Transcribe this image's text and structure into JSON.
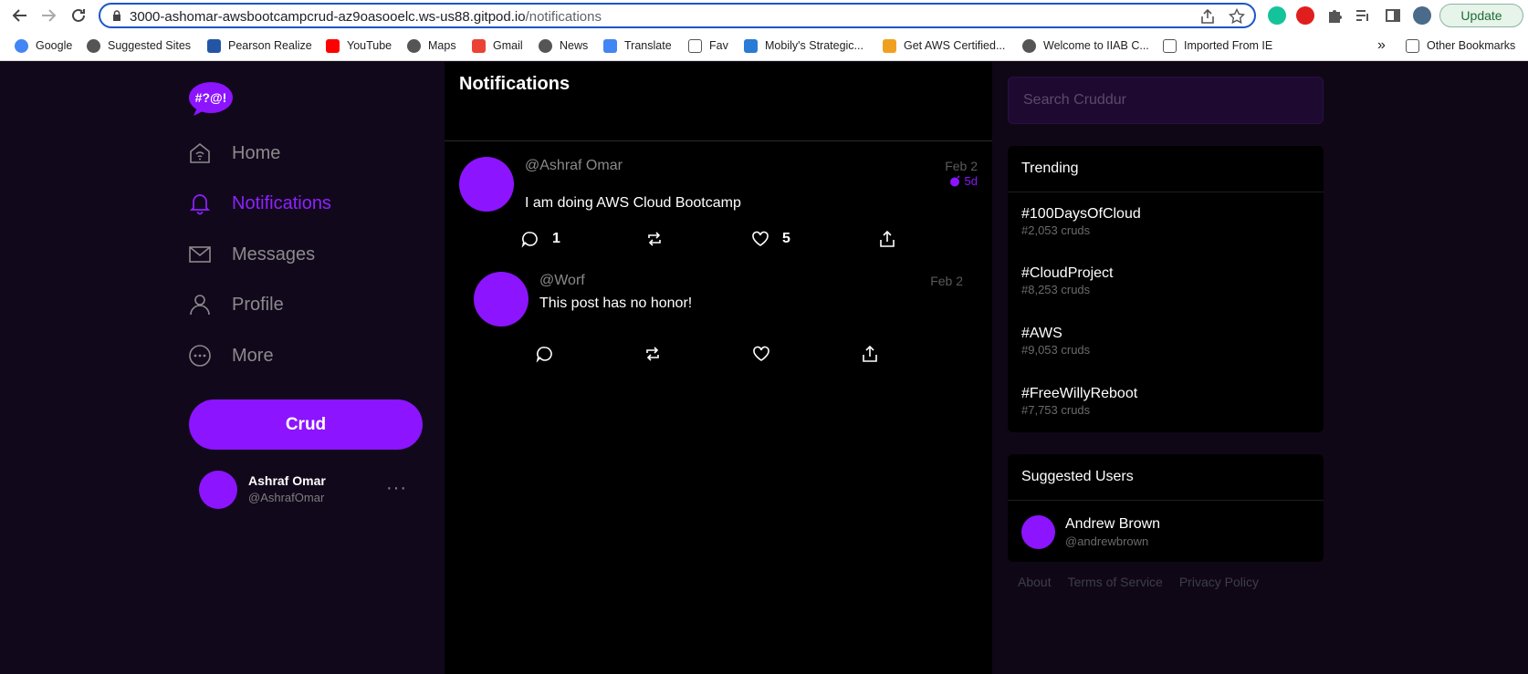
{
  "browser": {
    "url_host": "3000-ashomar-awsbootcampcrud-az9oasooelc.ws-us88.gitpod.io",
    "url_path": "/notifications",
    "update_label": "Update",
    "bookmarks": [
      {
        "label": "Google",
        "icon": "google-icon"
      },
      {
        "label": "Suggested Sites",
        "icon": "globe-icon"
      },
      {
        "label": "Pearson Realize",
        "icon": "pearson-icon"
      },
      {
        "label": "YouTube",
        "icon": "youtube-icon"
      },
      {
        "label": "Maps",
        "icon": "globe-icon"
      },
      {
        "label": "Gmail",
        "icon": "gmail-icon"
      },
      {
        "label": "News",
        "icon": "globe-icon"
      },
      {
        "label": "Translate",
        "icon": "translate-icon"
      },
      {
        "label": "Fav",
        "icon": "folder-icon"
      },
      {
        "label": "Mobily's Strategic...",
        "icon": "mobily-icon"
      },
      {
        "label": "Get AWS Certified...",
        "icon": "aws-icon"
      },
      {
        "label": "Welcome to IIAB C...",
        "icon": "globe-icon"
      },
      {
        "label": "Imported From IE",
        "icon": "folder-icon"
      }
    ],
    "overflow_label": "»",
    "other_bookmarks_label": "Other Bookmarks"
  },
  "sidebar": {
    "logo_text": "#?@!",
    "items": [
      {
        "label": "Home",
        "icon": "home-icon",
        "active": false
      },
      {
        "label": "Notifications",
        "icon": "bell-icon",
        "active": true
      },
      {
        "label": "Messages",
        "icon": "envelope-icon",
        "active": false
      },
      {
        "label": "Profile",
        "icon": "user-icon",
        "active": false
      },
      {
        "label": "More",
        "icon": "more-circle-icon",
        "active": false
      }
    ],
    "crud_label": "Crud",
    "user": {
      "name": "Ashraf Omar",
      "handle": "@AshrafOmar",
      "more": "···"
    }
  },
  "feed": {
    "title": "Notifications",
    "posts": [
      {
        "handle": "@Ashraf Omar",
        "date": "Feb 2",
        "ago": "5d",
        "content": "I am doing AWS Cloud Bootcamp",
        "replies": "1",
        "likes": "5"
      },
      {
        "handle": "@Worf",
        "date": "Feb 2",
        "content": "This post has no honor!",
        "replies": "",
        "likes": ""
      }
    ]
  },
  "right": {
    "search_placeholder": "Search Cruddur",
    "trending_title": "Trending",
    "trends": [
      {
        "tag": "#100DaysOfCloud",
        "count": "#2,053 cruds"
      },
      {
        "tag": "#CloudProject",
        "count": "#8,253 cruds"
      },
      {
        "tag": "#AWS",
        "count": "#9,053 cruds"
      },
      {
        "tag": "#FreeWillyReboot",
        "count": "#7,753 cruds"
      }
    ],
    "suggested_title": "Suggested Users",
    "suggested": {
      "name": "Andrew Brown",
      "handle": "@andrewbrown"
    },
    "footer": [
      "About",
      "Terms of Service",
      "Privacy Policy"
    ]
  },
  "colors": {
    "accent": "#8c14ff",
    "background": "#0f0716",
    "feed_bg": "#000000"
  }
}
